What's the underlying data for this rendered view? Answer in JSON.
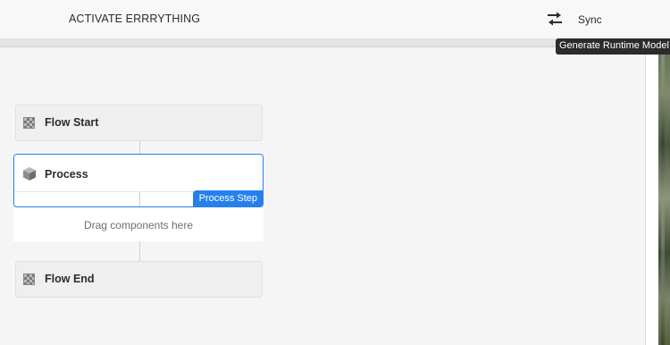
{
  "header": {
    "title": "ACTIVATE ERRRYTHING",
    "sync_icon": "sync-arrows-icon",
    "sync_label": "Sync"
  },
  "tooltip": {
    "text": "Generate Runtime Model"
  },
  "flow": {
    "start": {
      "label": "Flow Start",
      "icon": "checkered-flag-icon"
    },
    "process": {
      "label": "Process",
      "icon": "cube-icon",
      "badge": "Process Step"
    },
    "dropzone": {
      "text": "Drag components here"
    },
    "end": {
      "label": "Flow End",
      "icon": "checkered-flag-icon"
    }
  },
  "colors": {
    "accent": "#2680eb",
    "tooltip_bg": "#2b2b2b",
    "canvas_bg": "#f5f5f5"
  }
}
